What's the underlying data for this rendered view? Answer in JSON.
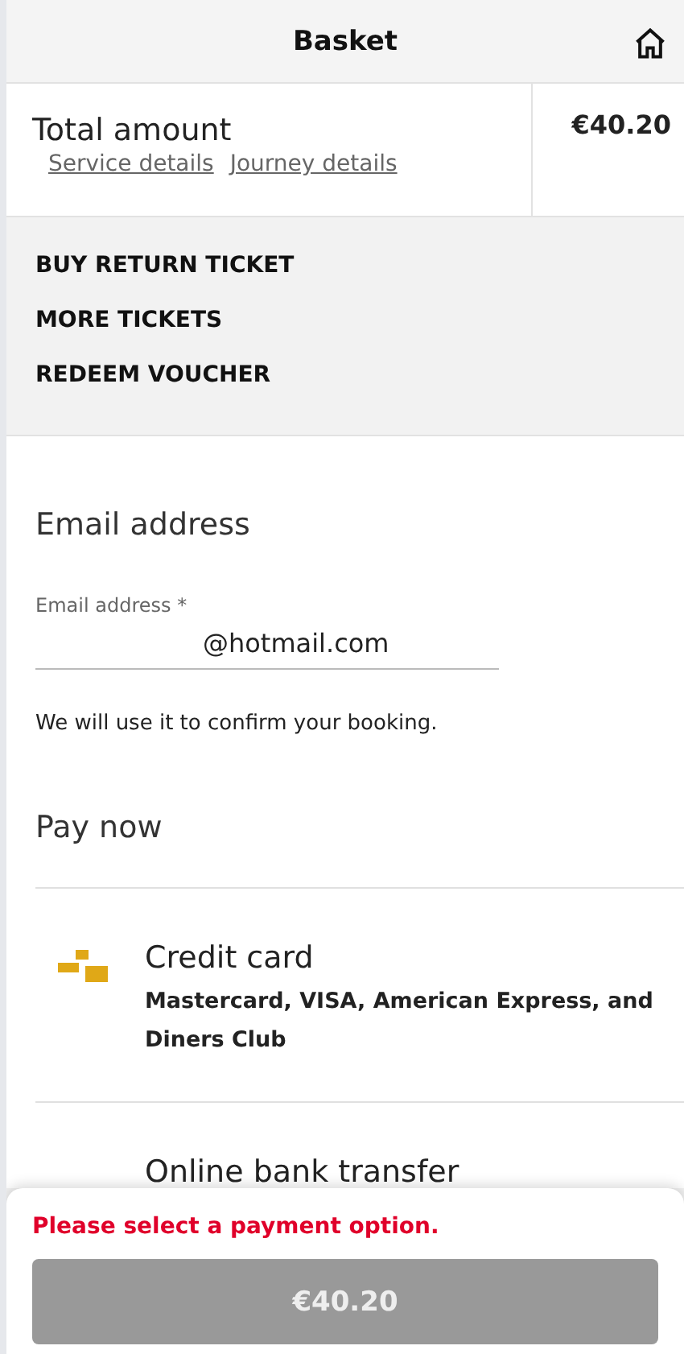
{
  "header": {
    "title": "Basket"
  },
  "summary": {
    "label": "Total amount",
    "links": [
      "Service details",
      "Journey details"
    ],
    "amount": "€40.20"
  },
  "actions": [
    "BUY RETURN TICKET",
    "MORE TICKETS",
    "REDEEM VOUCHER"
  ],
  "email": {
    "heading": "Email address",
    "label": "Email address *",
    "value": "@hotmail.com",
    "helper": "We will use it to confirm your booking."
  },
  "payment": {
    "heading": "Pay now",
    "options": [
      {
        "kind": "card",
        "title": "Credit card",
        "description": "Mastercard, VISA, American Express, and Diners Club"
      },
      {
        "kind": "bank",
        "title": "Online bank transfer"
      }
    ]
  },
  "footer": {
    "error": "Please select a payment option.",
    "button": {
      "label": "€40.20",
      "disabled": true
    }
  }
}
